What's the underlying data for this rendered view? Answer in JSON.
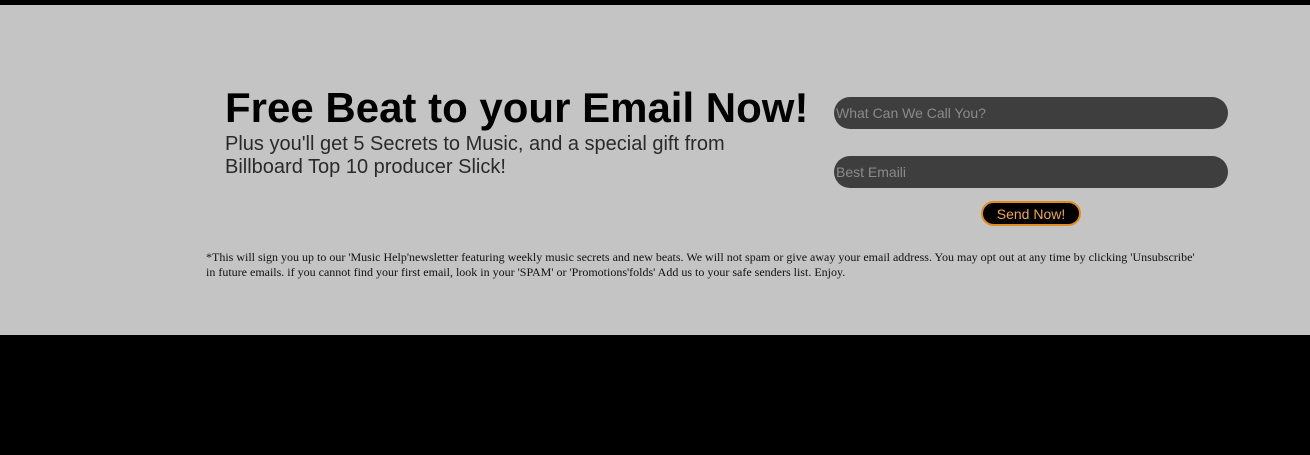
{
  "signup": {
    "headline": "Free Beat to your Email Now!",
    "subheadline": "Plus you'll get 5 Secrets to Music, and a special gift from Billboard Top 10 producer Slick!",
    "name_placeholder": "What Can We Call You?",
    "email_placeholder": "Best Emaili",
    "send_label": "Send Now!",
    "disclaimer": "*This will sign you up to our 'Music Help'newsletter featuring weekly music secrets and new beats. We will not spam or give away your email address. You may opt out at any time by clicking 'Unsubscribe' in future emails. if you cannot find your first email, look in your 'SPAM' or 'Promotions'folds' Add us to your safe senders list. Enjoy."
  },
  "colors": {
    "panel_background": "#c4c4c4",
    "page_background": "#000000",
    "input_background": "#3f3e3f",
    "button_border": "#e08b1f",
    "button_text": "#f0a64a"
  }
}
